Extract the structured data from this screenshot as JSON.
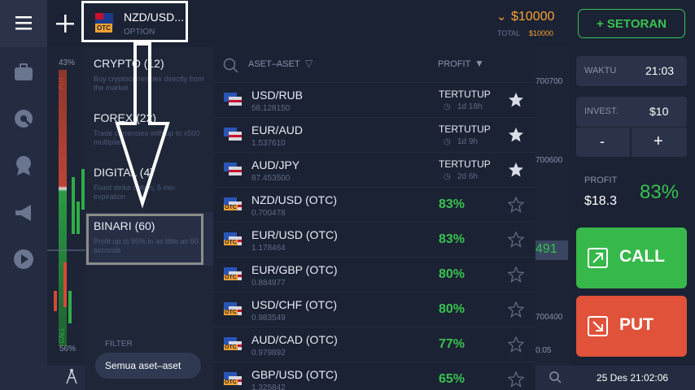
{
  "asset_selector": {
    "name": "NZD/USD...",
    "type": "OPTION",
    "otc_badge": "OTC"
  },
  "balance": {
    "amount": "$10000",
    "total_label": "TOTAL",
    "total_value": "$10000"
  },
  "deposit_button": "+ SETORAN",
  "chart": {
    "pct_top": "43%",
    "pct_bottom": "56%",
    "put_label": "PUT",
    "call_label": "CALL",
    "price_ticks": [
      "700700",
      "700600",
      "700400"
    ],
    "current_price": "491",
    "time_tick": "0:05"
  },
  "categories": [
    {
      "title": "CRYPTO (12)",
      "desc": "Buy cryptocurrencies directly from the market"
    },
    {
      "title": "FOREX (22)",
      "desc": "Trade currencies with up to x500 multiplier"
    },
    {
      "title": "DIGITAL (4)",
      "desc": "Fixed strike option, 5 min expiration"
    },
    {
      "title": "BINARI (60)",
      "desc": "Profit up to 95% in as little as 60 seconds"
    }
  ],
  "filter": {
    "label": "FILTER",
    "value": "Semua aset–aset"
  },
  "asset_header": {
    "assets": "ASET–ASET",
    "profit": "PROFIT"
  },
  "assets": [
    {
      "name": "USD/RUB",
      "price": "58.128150",
      "status": "TERTUTUP",
      "time": "1d 18h",
      "fav": true,
      "otc": false
    },
    {
      "name": "EUR/AUD",
      "price": "1.537610",
      "status": "TERTUTUP",
      "time": "1d 9h",
      "fav": true,
      "otc": false
    },
    {
      "name": "AUD/JPY",
      "price": "87.453500",
      "status": "TERTUTUP",
      "time": "2d 6h",
      "fav": true,
      "otc": false
    },
    {
      "name": "NZD/USD (OTC)",
      "price": "0.700478",
      "profit": "83%",
      "fav": false,
      "otc": true
    },
    {
      "name": "EUR/USD (OTC)",
      "price": "1.178464",
      "profit": "83%",
      "fav": false,
      "otc": true
    },
    {
      "name": "EUR/GBP (OTC)",
      "price": "0.884977",
      "profit": "80%",
      "fav": false,
      "otc": true
    },
    {
      "name": "USD/CHF (OTC)",
      "price": "0.983549",
      "profit": "80%",
      "fav": false,
      "otc": true
    },
    {
      "name": "AUD/CAD (OTC)",
      "price": "0.979892",
      "profit": "77%",
      "fav": false,
      "otc": true
    },
    {
      "name": "GBP/USD (OTC)",
      "price": "1.325842",
      "profit": "65%",
      "fav": false,
      "otc": true
    }
  ],
  "trade": {
    "time_label": "WAKTU",
    "time_value": "21:03",
    "invest_label": "INVEST.",
    "invest_value": "$10",
    "minus": "-",
    "plus": "+",
    "profit_label": "PROFIT",
    "profit_amount": "$18.3",
    "profit_pct": "83%",
    "call": "CALL",
    "put": "PUT"
  },
  "datetime": "25 Des 21:02:06",
  "colors": {
    "green": "#36c34e",
    "red": "#e0523a",
    "orange": "#f7a232"
  }
}
